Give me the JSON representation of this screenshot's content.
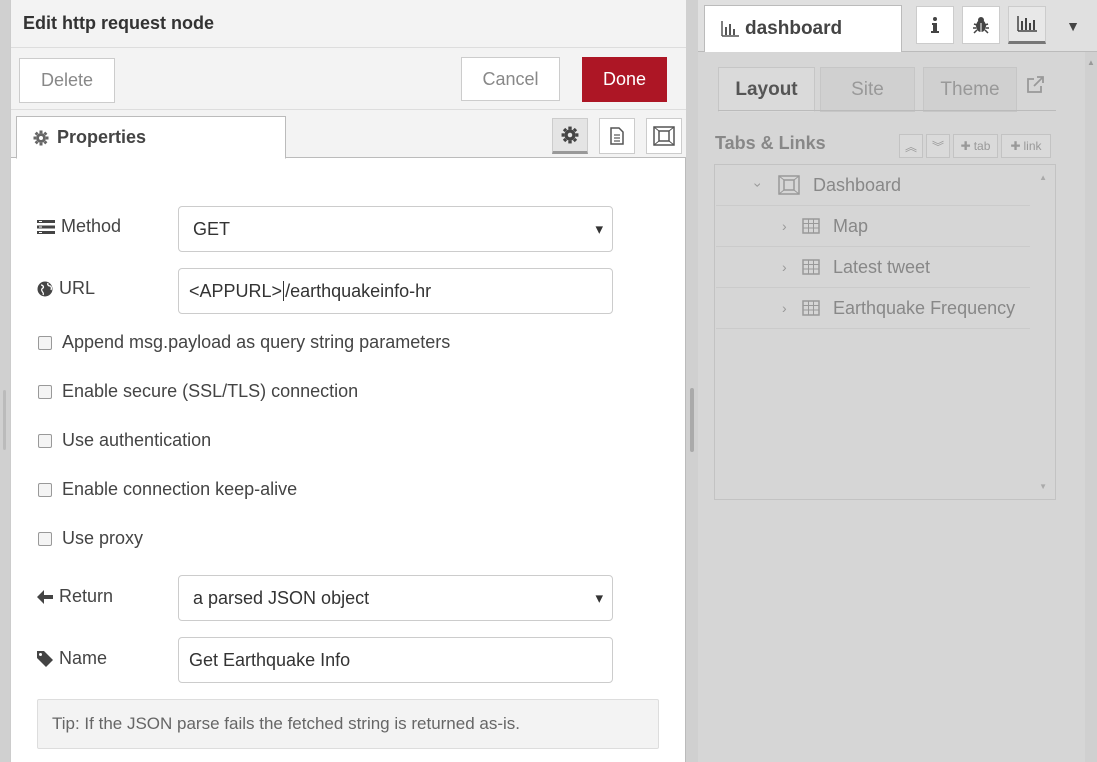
{
  "editor": {
    "title": "Edit http request node",
    "delete_label": "Delete",
    "cancel_label": "Cancel",
    "done_label": "Done",
    "tab_label": "Properties",
    "fields": {
      "method": {
        "label": "Method",
        "value": "GET"
      },
      "url": {
        "label": "URL",
        "value_prefix": "<APPURL>",
        "value_suffix": "/earthquakeinfo-hr"
      },
      "return": {
        "label": "Return",
        "value": "a parsed JSON object"
      },
      "name": {
        "label": "Name",
        "value": "Get Earthquake Info"
      }
    },
    "checkboxes": [
      {
        "label": "Append msg.payload as query string parameters",
        "checked": false
      },
      {
        "label": "Enable secure (SSL/TLS) connection",
        "checked": false
      },
      {
        "label": "Use authentication",
        "checked": false
      },
      {
        "label": "Enable connection keep-alive",
        "checked": false
      },
      {
        "label": "Use proxy",
        "checked": false
      }
    ],
    "tip": "Tip: If the JSON parse fails the fetched string is returned as-is."
  },
  "sidebar": {
    "tab_label": "dashboard",
    "icons": [
      "info-icon",
      "bug-icon",
      "chart-icon"
    ],
    "dashboard_tabs": {
      "layout": "Layout",
      "site": "Site",
      "theme": "Theme"
    },
    "section_title": "Tabs & Links",
    "buttons": {
      "tab": "tab",
      "link": "link"
    },
    "tree": {
      "root": "Dashboard",
      "children": [
        "Map",
        "Latest tweet",
        "Earthquake Frequency"
      ]
    }
  },
  "colors": {
    "done_button": "#ad1625",
    "sidebar_bg": "#d6d6d6"
  }
}
